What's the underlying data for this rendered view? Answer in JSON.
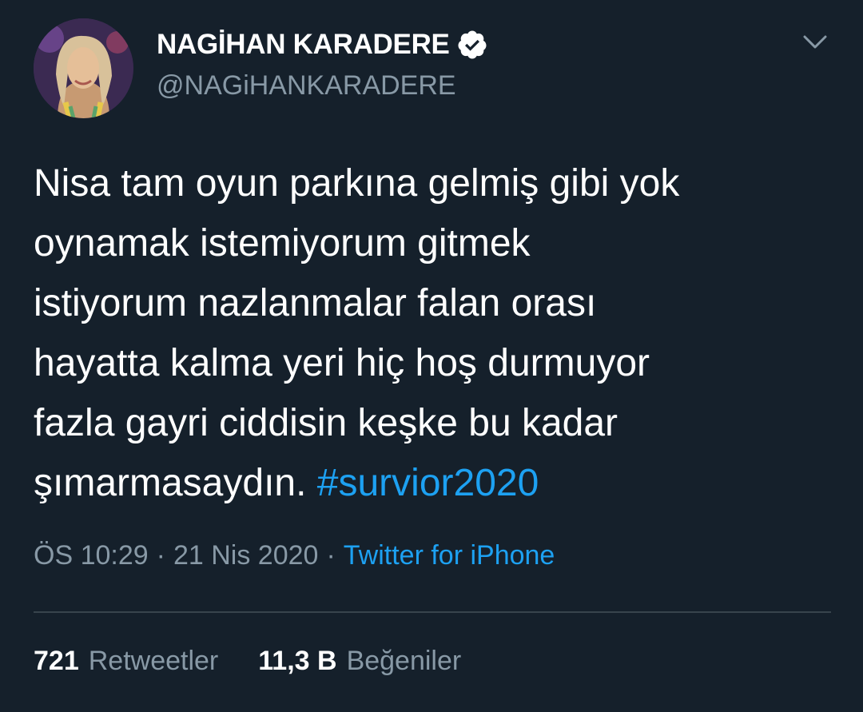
{
  "tweet": {
    "author": {
      "display_name": "NAGİHAN KARADERE",
      "handle": "@NAGiHANKARADERE",
      "verified": true,
      "avatar_icon": "profile-photo"
    },
    "text_lines": [
      "Nisa tam oyun parkına gelmiş gibi yok",
      "oynamak istemiyorum gitmek",
      "istiyorum nazlanmalar falan orası",
      "hayatta kalma yeri hiç hoş durmuyor",
      "fazla gayri ciddisin keşke bu kadar",
      "şımarmasaydın."
    ],
    "hashtag": "#survior2020",
    "time": "ÖS 10:29",
    "date": "21 Nis 2020",
    "separator": "·",
    "source": "Twitter for iPhone",
    "stats": {
      "retweets_count": "721",
      "retweets_label": "Retweetler",
      "likes_count": "11,3 B",
      "likes_label": "Beğeniler"
    }
  },
  "colors": {
    "background": "#15202b",
    "text": "#ffffff",
    "secondary_text": "#8899a6",
    "link": "#1da1f2",
    "divider": "#38444d"
  },
  "icons": {
    "verified": "verified-badge-icon",
    "menu": "chevron-down-icon"
  }
}
